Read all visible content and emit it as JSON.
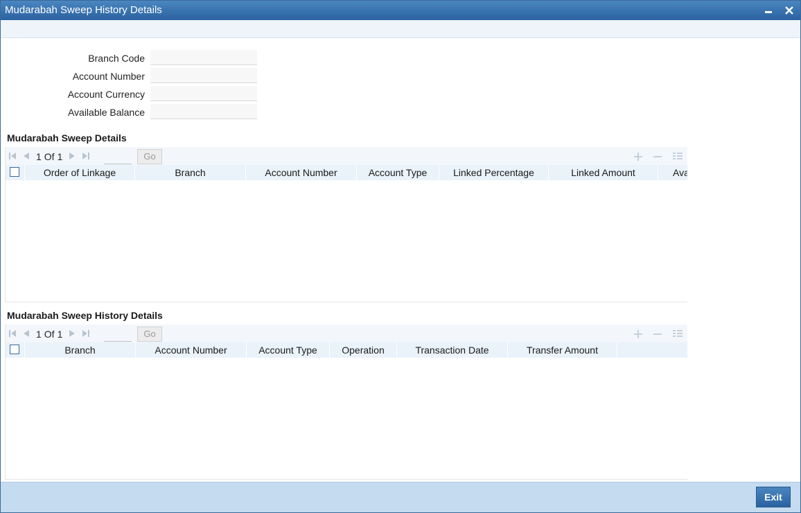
{
  "window": {
    "title": "Mudarabah Sweep History Details"
  },
  "form": {
    "fields": [
      {
        "label": "Branch Code",
        "value": ""
      },
      {
        "label": "Account Number",
        "value": ""
      },
      {
        "label": "Account Currency",
        "value": ""
      },
      {
        "label": "Available Balance",
        "value": ""
      }
    ]
  },
  "sweep_details": {
    "title": "Mudarabah Sweep Details",
    "pager": {
      "current": "1",
      "of_label": "Of",
      "total": "1",
      "go_label": "Go"
    },
    "columns": [
      "Order of Linkage",
      "Branch",
      "Account Number",
      "Account Type",
      "Linked Percentage",
      "Linked Amount",
      "Ava"
    ],
    "rows": []
  },
  "history_details": {
    "title": "Mudarabah Sweep History Details",
    "pager": {
      "current": "1",
      "of_label": "Of",
      "total": "1",
      "go_label": "Go"
    },
    "columns": [
      "Branch",
      "Account Number",
      "Account Type",
      "Operation",
      "Transaction Date",
      "Transfer Amount"
    ],
    "rows": []
  },
  "footer": {
    "exit_label": "Exit"
  },
  "icons": {
    "minimize": "minimize-icon",
    "close": "close-icon",
    "first": "first-page-icon",
    "prev": "prev-page-icon",
    "next": "next-page-icon",
    "last": "last-page-icon",
    "add": "add-row-icon",
    "delete": "delete-row-icon",
    "list": "list-view-icon"
  },
  "colors": {
    "titlebar": "#2a62a0",
    "header_bg": "#eaf2fa",
    "footer_bg": "#c5dbf0"
  }
}
